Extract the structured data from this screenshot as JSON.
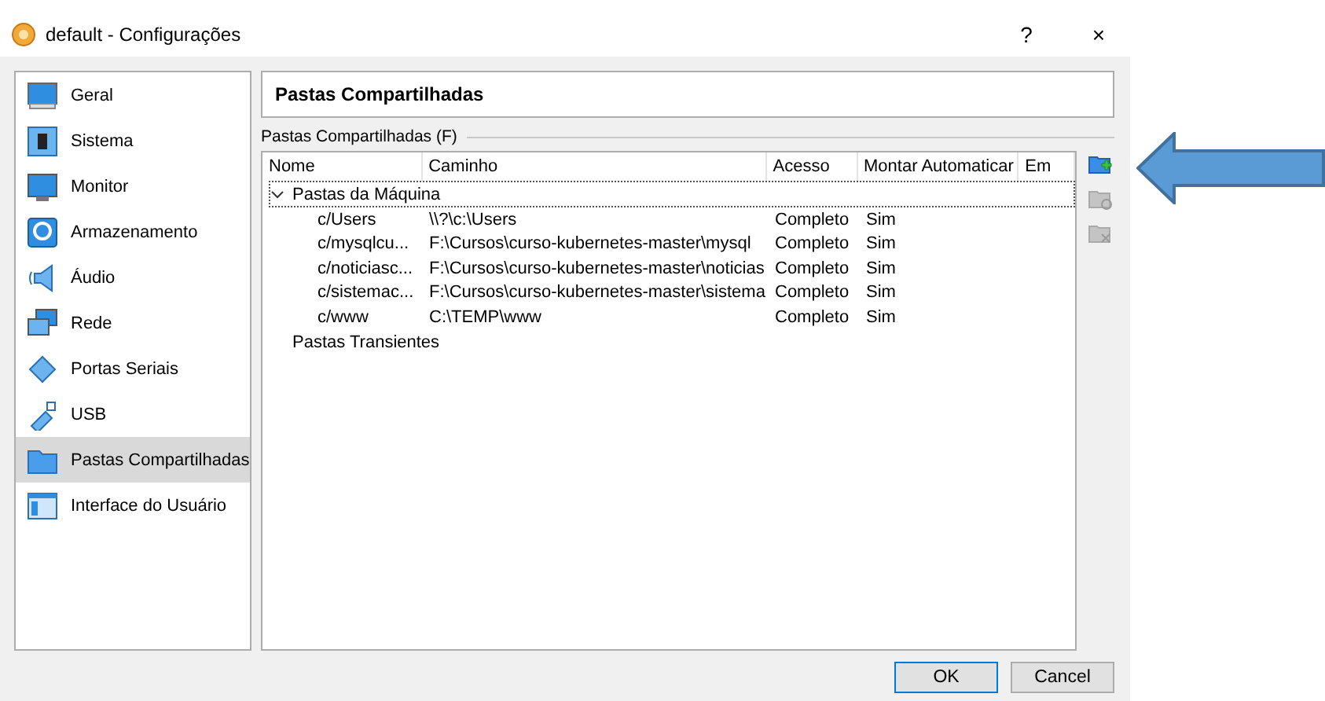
{
  "window": {
    "title": "default - Configurações",
    "buttons": [
      "?",
      "×"
    ]
  },
  "sidebar": {
    "items": [
      {
        "label": "Geral",
        "selected": false
      },
      {
        "label": "Sistema",
        "selected": false
      },
      {
        "label": "Monitor",
        "selected": false
      },
      {
        "label": "Armazenamento",
        "selected": false
      },
      {
        "label": "Áudio",
        "selected": false
      },
      {
        "label": "Rede",
        "selected": false
      },
      {
        "label": "Portas Seriais",
        "selected": false
      },
      {
        "label": "USB",
        "selected": false
      },
      {
        "label": "Pastas Compartilhadas",
        "selected": true
      },
      {
        "label": "Interface do Usuário",
        "selected": false
      }
    ]
  },
  "page_title": "Pastas Compartilhadas",
  "group_label": "Pastas Compartilhadas (F)",
  "table": {
    "columns": [
      "Nome",
      "Caminho",
      "Acesso",
      "Montar Automaticar",
      "Em"
    ],
    "groups": [
      {
        "label": "Pastas da Máquina",
        "expanded": true,
        "focused": true,
        "rows": [
          [
            "c/Users",
            "\\\\?\\c:\\Users",
            "Completo",
            "Sim"
          ],
          [
            "c/mysqlcu...",
            "F:\\Cursos\\curso-kubernetes-master\\mysql",
            "Completo",
            "Sim"
          ],
          [
            "c/noticiasc...",
            "F:\\Cursos\\curso-kubernetes-master\\noticias",
            "Completo",
            "Sim"
          ],
          [
            "c/sistemac...",
            "F:\\Cursos\\curso-kubernetes-master\\sistema",
            "Completo",
            "Sim"
          ],
          [
            "c/www",
            "C:\\TEMP\\www",
            "Completo",
            "Sim"
          ]
        ]
      },
      {
        "label": "Pastas Transientes",
        "focused": false
      }
    ]
  },
  "tools": [
    {
      "disabled": false
    },
    {
      "disabled": true
    },
    {
      "disabled": true
    }
  ],
  "buttons": [
    {
      "label": "OK",
      "default": true
    },
    {
      "label": "Cancel",
      "default": false
    }
  ]
}
